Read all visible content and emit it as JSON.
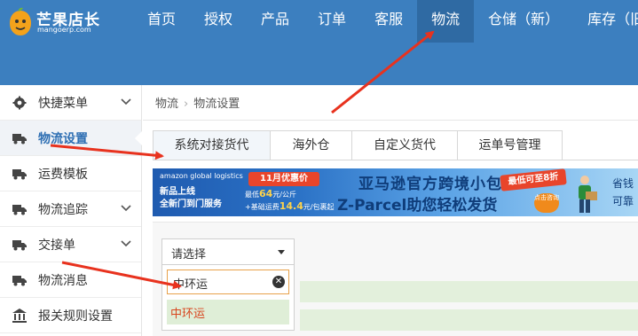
{
  "app": {
    "logo_title": "芒果店长",
    "logo_url": "mangoerp.com"
  },
  "nav": {
    "items": [
      "首页",
      "授权",
      "产品",
      "订单",
      "客服",
      "物流",
      "仓储（新）",
      "库存（旧"
    ],
    "active_index": 5
  },
  "sidebar": {
    "items": [
      {
        "label": "快捷菜单",
        "icon": "gear-icon",
        "has_chevron": true
      },
      {
        "label": "物流设置",
        "icon": "truck-icon",
        "has_chevron": false,
        "active": true
      },
      {
        "label": "运费模板",
        "icon": "truck-icon",
        "has_chevron": false
      },
      {
        "label": "物流追踪",
        "icon": "truck-icon",
        "has_chevron": true
      },
      {
        "label": "交接单",
        "icon": "truck-icon",
        "has_chevron": true
      },
      {
        "label": "物流消息",
        "icon": "truck-icon",
        "has_chevron": false
      },
      {
        "label": "报关规则设置",
        "icon": "bank-icon",
        "has_chevron": false
      }
    ]
  },
  "breadcrumb": {
    "root": "物流",
    "separator": "›",
    "current": "物流设置"
  },
  "tabs": [
    "系统对接货代",
    "海外仓",
    "自定义货代",
    "运单号管理"
  ],
  "active_tab": 0,
  "banner": {
    "brand": "amazon global logistics",
    "line1": "新品上线",
    "line2": "全新门到门服务",
    "promo": "11月优惠价",
    "price1_prefix": "最低",
    "price1_value": "64",
    "price1_suffix": "元/公斤",
    "price2_prefix": "+基础运费",
    "price2_value": "14.4",
    "price2_suffix": "元/包裹起",
    "title": "亚马逊官方跨境小包",
    "subtitle": "Z-Parcel助您轻松发货",
    "tag": "最低可至8折",
    "button": "点击咨询",
    "right1": "省钱",
    "right2": "可靠"
  },
  "filter": {
    "select_value": "请选择",
    "search_value": "中环运",
    "option": "中环运",
    "clear_symbol": "✕"
  },
  "colors": {
    "header": "#3c7fbf",
    "nav_active": "#2f6aa3",
    "arrow": "#e8321e",
    "option_text": "#d8461f",
    "option_bg": "#dfeed7"
  }
}
